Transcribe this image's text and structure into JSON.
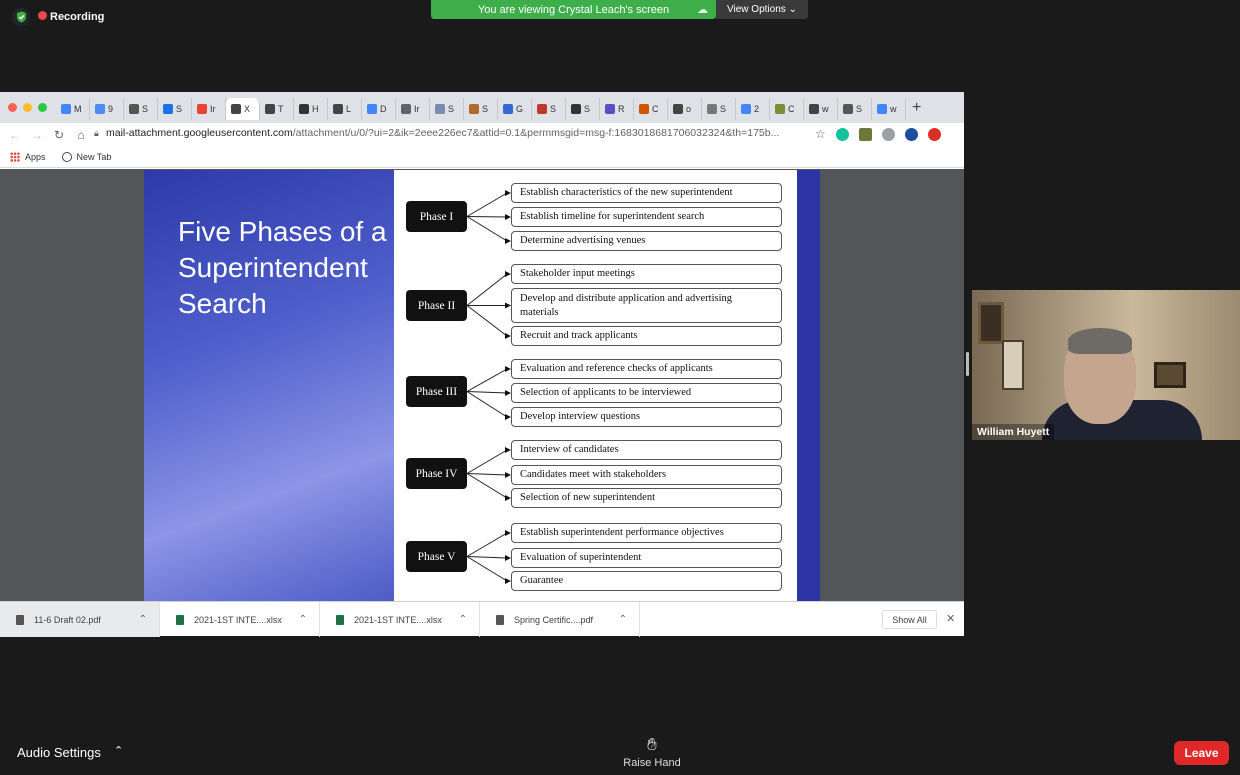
{
  "zoom": {
    "recording_label": "Recording",
    "viewing_banner": "You are viewing Crystal Leach's screen",
    "view_options_label": "View Options",
    "audio_settings_label": "Audio Settings",
    "raise_hand_label": "Raise Hand",
    "leave_label": "Leave",
    "participant_name": "William Huyett"
  },
  "browser": {
    "tabs": [
      {
        "label": "M",
        "color": "#4285f4"
      },
      {
        "label": "9",
        "color": "#4c8bf5"
      },
      {
        "label": "S",
        "color": "#555555"
      },
      {
        "label": "S",
        "color": "#1a73e8"
      },
      {
        "label": "Ir",
        "color": "#ea4335"
      },
      {
        "label": "X",
        "color": "#444444"
      },
      {
        "label": "T",
        "color": "#444444"
      },
      {
        "label": "H",
        "color": "#333333"
      },
      {
        "label": "L",
        "color": "#444444"
      },
      {
        "label": "D",
        "color": "#4285f4"
      },
      {
        "label": "Ir",
        "color": "#5f6368"
      },
      {
        "label": "S",
        "color": "#7a8bb0"
      },
      {
        "label": "S",
        "color": "#b26a2c"
      },
      {
        "label": "G",
        "color": "#3367d6"
      },
      {
        "label": "S",
        "color": "#c0392b"
      },
      {
        "label": "S",
        "color": "#333333"
      },
      {
        "label": "R",
        "color": "#5b4fc4"
      },
      {
        "label": "C",
        "color": "#d35400"
      },
      {
        "label": "o",
        "color": "#444444"
      },
      {
        "label": "S",
        "color": "#777777"
      },
      {
        "label": "2",
        "color": "#4285f4"
      },
      {
        "label": "C",
        "color": "#7b8d3a"
      },
      {
        "label": "w",
        "color": "#444444"
      },
      {
        "label": "S",
        "color": "#555555"
      },
      {
        "label": "w",
        "color": "#4285f4"
      }
    ],
    "url_host": "mail-attachment.googleusercontent.com",
    "url_path": "/attachment/u/0/?ui=2&ik=2eee226ec7&attid=0.1&permmsgid=msg-f:1683018681706032324&th=175b...",
    "bookmarks": [
      {
        "label": "Apps"
      },
      {
        "label": "New Tab"
      }
    ],
    "downloads": [
      {
        "label": "11-6 Draft 02.pdf"
      },
      {
        "label": "2021-1ST INTE....xlsx"
      },
      {
        "label": "2021-1ST INTE....xlsx"
      },
      {
        "label": "Spring Certific....pdf"
      }
    ],
    "show_all_label": "Show All"
  },
  "slide": {
    "title": "Five Phases of a Superintendent Search",
    "phases": [
      {
        "label": "Phase I",
        "steps": [
          "Establish characteristics of the new superintendent",
          "Establish timeline for superintendent search",
          "Determine advertising venues"
        ]
      },
      {
        "label": "Phase II",
        "steps": [
          "Stakeholder input meetings",
          "Develop and distribute application and advertising materials",
          "Recruit and track applicants"
        ]
      },
      {
        "label": "Phase III",
        "steps": [
          "Evaluation and reference checks of applicants",
          "Selection of applicants to be interviewed",
          "Develop interview questions"
        ]
      },
      {
        "label": "Phase IV",
        "steps": [
          "Interview of candidates",
          "Candidates meet with stakeholders",
          "Selection of new superintendent"
        ]
      },
      {
        "label": "Phase V",
        "steps": [
          "Establish superintendent performance objectives",
          "Evaluation of superintendent",
          "Guarantee"
        ]
      }
    ]
  }
}
